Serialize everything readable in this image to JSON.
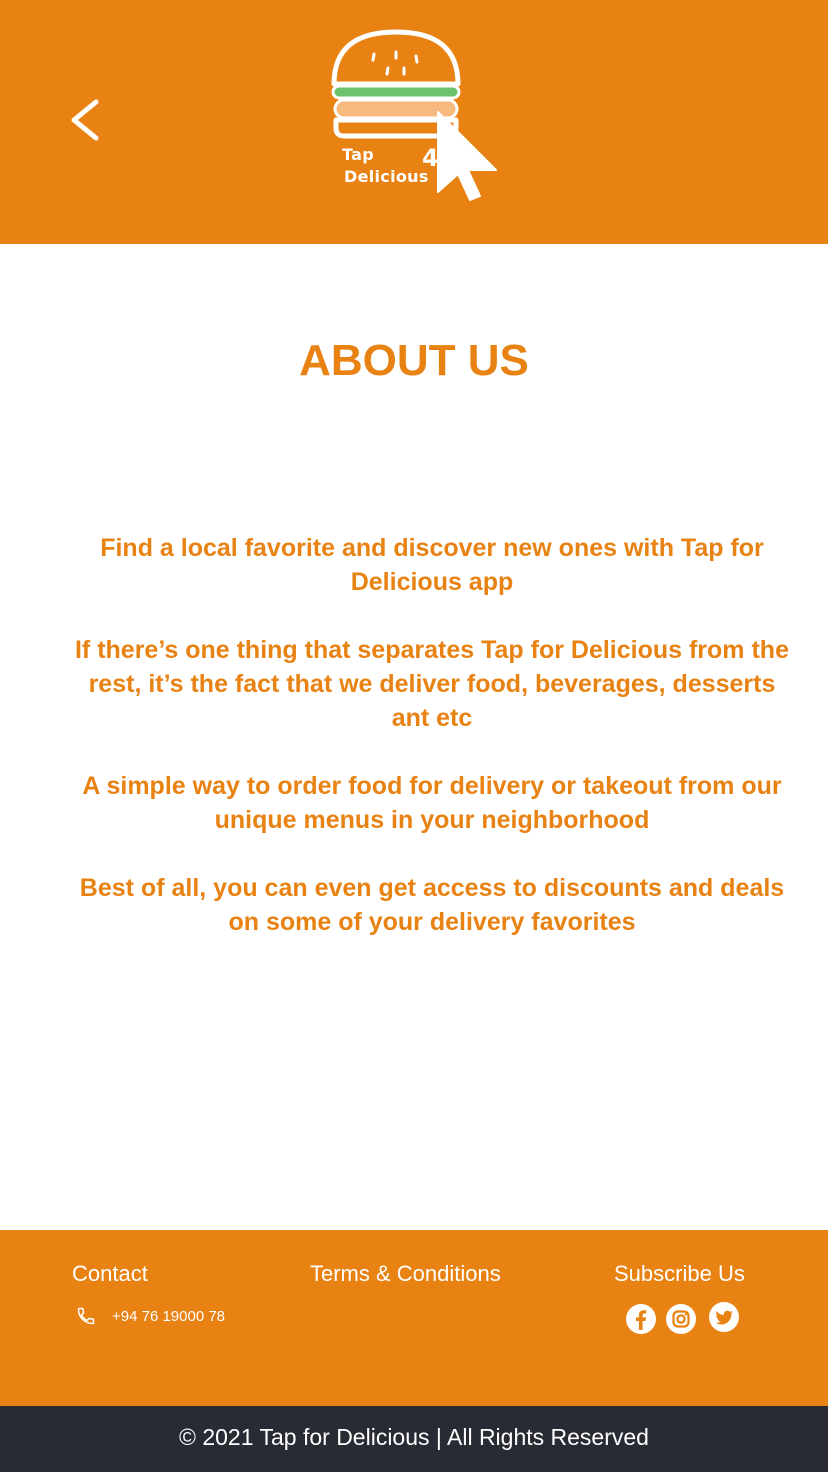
{
  "header": {
    "back_icon": "chevron-left-icon",
    "logo": {
      "line1": "Tap",
      "line2": "Delicious",
      "badge": "4"
    }
  },
  "main": {
    "title": "ABOUT US",
    "paragraphs": [
      "Find a local favorite and discover new ones with Tap for Delicious app",
      "If there’s one thing that separates Tap for Delicious from the rest, it’s the fact that we deliver food, beverages, desserts ant etc",
      "A simple way to order food for delivery or takeout from our unique menus in your neighborhood",
      "Best of all, you can even get access to discounts and deals on some of your delivery favorites"
    ]
  },
  "footer": {
    "contact_heading": "Contact",
    "phone_icon": "phone-icon",
    "phone": "+94 76 19000 78",
    "terms_label": "Terms & Conditions",
    "subscribe_heading": "Subscribe Us",
    "social_icons": [
      "facebook-icon",
      "instagram-icon",
      "twitter-icon"
    ],
    "copyright": "© 2021 Tap for Delicious | All Rights Reserved"
  },
  "colors": {
    "brand_orange": "#E88212",
    "copyright_bg": "#292B34",
    "logo_green": "#6CC36C",
    "logo_peach": "#F8B97E",
    "text_on_brand": "#FFFFFF"
  }
}
